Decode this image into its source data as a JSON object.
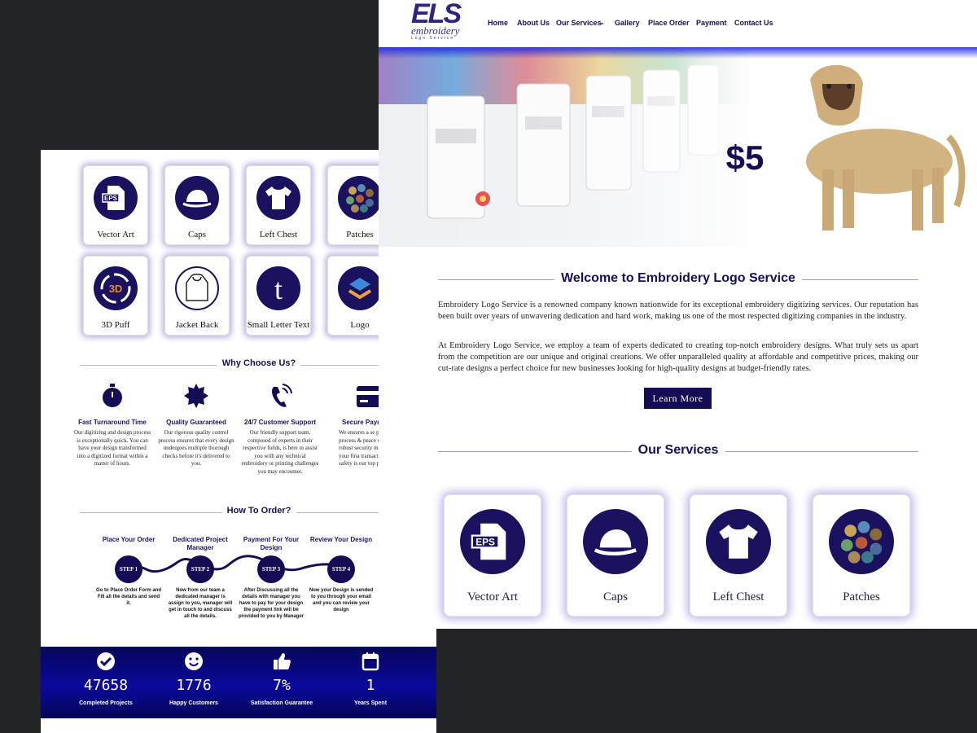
{
  "left_page": {
    "services": [
      {
        "label": "Vector Art",
        "icon": "eps-file-icon"
      },
      {
        "label": "Caps",
        "icon": "cap-icon"
      },
      {
        "label": "Left Chest",
        "icon": "tshirt-icon"
      },
      {
        "label": "Patches",
        "icon": "patches-icon"
      },
      {
        "label": "3D Puff",
        "icon": "3d-puff-icon"
      },
      {
        "label": "Jacket Back",
        "icon": "hoodie-icon"
      },
      {
        "label": "Small Letter Text",
        "icon": "letter-t-icon"
      },
      {
        "label": "Logo",
        "icon": "logo-hands-icon"
      }
    ],
    "why_title": "Why Choose Us?",
    "why": [
      {
        "title": "Fast Turnaround Time",
        "icon": "stopwatch-icon",
        "text": "Our digitizing and design process is exceptionally quick. You can have your design transformed into a digitized format within a matter of hours."
      },
      {
        "title": "Quality Guaranteed",
        "icon": "badge-icon",
        "text": "Our rigorous quality control process ensures that every design undergoes multiple thorough checks before it's delivered to you."
      },
      {
        "title": "24/7 Customer Support",
        "icon": "phone-icon",
        "text": "Our friendly support team, composed of experts in their respective fields, is here to assist you with any technical embroidery or printing challenges you may encounter."
      },
      {
        "title": "Secure Payme",
        "icon": "credit-card-icon",
        "text": "We ensures a se payment process & peace of mind. We robust security mea protect your fina transactions. Your safety is our top pr"
      }
    ],
    "order_title": "How To Order?",
    "steps": [
      {
        "title": "Place Your Order",
        "badge": "STEP 1",
        "text": "Go to Place Order Form and Fill all the details and send it."
      },
      {
        "title": "Dedicated Project Manager",
        "badge": "STEP 2",
        "text": "Now from our team a dedicated manager is assign to you, manager will get in touch to and discuss all the details."
      },
      {
        "title": "Payment For Your Design",
        "badge": "STEP 3",
        "text": "After Discussing all the details with manager you have to pay for your design the payment link will be provided to you by Manager"
      },
      {
        "title": "Review Your Design",
        "badge": "STEP 4",
        "text": "Now your Design is sended to you through your email and you can review your design"
      }
    ],
    "stats": [
      {
        "value": "47658",
        "label": "Completed Projects",
        "icon": "check-circle-icon"
      },
      {
        "value": "1776",
        "label": "Happy Customers",
        "icon": "smiley-icon"
      },
      {
        "value": "7%",
        "label": "Satisfaction Guarantee",
        "icon": "thumbs-up-icon"
      },
      {
        "value": "1",
        "label": "Years Spent",
        "icon": "calendar-icon"
      }
    ]
  },
  "right_page": {
    "logo": {
      "letters": "ELS",
      "word": "embroidery",
      "sub": "Logo Service"
    },
    "nav": [
      "Home",
      "About Us",
      "Our Services",
      "Gallery",
      "Place Order",
      "Payment",
      "Contact Us"
    ],
    "hero": {
      "price": "$5"
    },
    "welcome_title": "Welcome to Embroidery Logo Service",
    "welcome_p1": "Embroidery Logo Service is a renowned company known nationwide for its exceptional embroidery digitizing services. Our reputation has been built over years of unwavering dedication and hard work, making us one of the most respected digitizing companies in the industry.",
    "welcome_p2": "At Embroidery Logo Service, we employ a team of experts dedicated to creating top-notch embroidery designs. What truly sets us apart from the competition are our unique and original creations. We offer unparalleled quality at affordable and competitive prices, making our cut-rate designs a perfect choice for new businesses looking for high-quality designs at budget-friendly rates.",
    "learn_more": "Learn More",
    "services_title": "Our Services",
    "services": [
      {
        "label": "Vector Art",
        "icon": "eps-file-icon"
      },
      {
        "label": "Caps",
        "icon": "cap-icon"
      },
      {
        "label": "Left Chest",
        "icon": "tshirt-icon"
      },
      {
        "label": "Patches",
        "icon": "patches-icon"
      }
    ]
  },
  "colors": {
    "navy": "#1a125e",
    "background": "#222326",
    "stats_band": "#0a0a9c"
  }
}
